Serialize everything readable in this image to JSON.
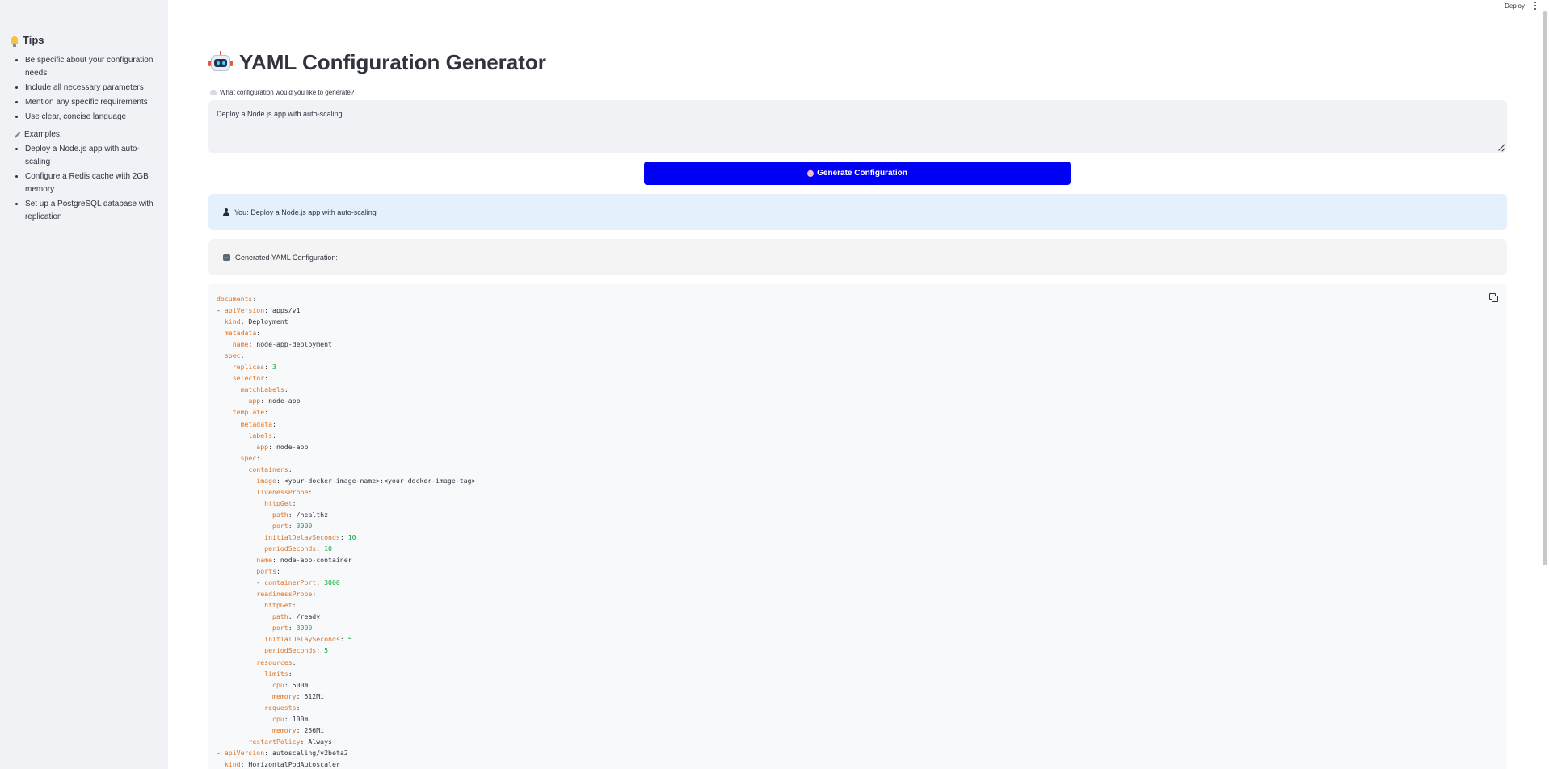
{
  "topbar": {
    "deploy_label": "Deploy"
  },
  "sidebar": {
    "tips_title": "Tips",
    "tips": [
      "Be specific about your configuration needs",
      "Include all necessary parameters",
      "Mention any specific requirements",
      "Use clear, concise language"
    ],
    "examples_title": "Examples:",
    "examples": [
      "Deploy a Node.js app with auto-scaling",
      "Configure a Redis cache with 2GB memory",
      "Set up a PostgreSQL database with replication"
    ]
  },
  "main": {
    "title": "YAML Configuration Generator",
    "prompt_label": "What configuration would you like to generate?",
    "prompt_value": "Deploy a Node.js app with auto-scaling",
    "generate_button": "Generate Configuration",
    "user_message": "You: Deploy a Node.js app with auto-scaling",
    "bot_message": "Generated YAML Configuration:"
  },
  "code": {
    "lines": [
      [
        [
          "k",
          "documents"
        ],
        [
          "p",
          ":"
        ]
      ],
      [
        [
          "p",
          "- "
        ],
        [
          "k",
          "apiVersion"
        ],
        [
          "p",
          ": apps/v1"
        ]
      ],
      [
        [
          "p",
          "  "
        ],
        [
          "k",
          "kind"
        ],
        [
          "p",
          ": Deployment"
        ]
      ],
      [
        [
          "p",
          "  "
        ],
        [
          "k",
          "metadata"
        ],
        [
          "p",
          ":"
        ]
      ],
      [
        [
          "p",
          "    "
        ],
        [
          "k",
          "name"
        ],
        [
          "p",
          ": node-app-deployment"
        ]
      ],
      [
        [
          "p",
          "  "
        ],
        [
          "k",
          "spec"
        ],
        [
          "p",
          ":"
        ]
      ],
      [
        [
          "p",
          "    "
        ],
        [
          "k",
          "replicas"
        ],
        [
          "p",
          ": "
        ],
        [
          "n",
          "3"
        ]
      ],
      [
        [
          "p",
          "    "
        ],
        [
          "k",
          "selector"
        ],
        [
          "p",
          ":"
        ]
      ],
      [
        [
          "p",
          "      "
        ],
        [
          "k",
          "matchLabels"
        ],
        [
          "p",
          ":"
        ]
      ],
      [
        [
          "p",
          "        "
        ],
        [
          "k",
          "app"
        ],
        [
          "p",
          ": node-app"
        ]
      ],
      [
        [
          "p",
          "    "
        ],
        [
          "k",
          "template"
        ],
        [
          "p",
          ":"
        ]
      ],
      [
        [
          "p",
          "      "
        ],
        [
          "k",
          "metadata"
        ],
        [
          "p",
          ":"
        ]
      ],
      [
        [
          "p",
          "        "
        ],
        [
          "k",
          "labels"
        ],
        [
          "p",
          ":"
        ]
      ],
      [
        [
          "p",
          "          "
        ],
        [
          "k",
          "app"
        ],
        [
          "p",
          ": node-app"
        ]
      ],
      [
        [
          "p",
          "      "
        ],
        [
          "k",
          "spec"
        ],
        [
          "p",
          ":"
        ]
      ],
      [
        [
          "p",
          "        "
        ],
        [
          "k",
          "containers"
        ],
        [
          "p",
          ":"
        ]
      ],
      [
        [
          "p",
          "        - "
        ],
        [
          "k",
          "image"
        ],
        [
          "p",
          ": <your-docker-image-name>:<your-docker-image-tag>"
        ]
      ],
      [
        [
          "p",
          "          "
        ],
        [
          "k",
          "livenessProbe"
        ],
        [
          "p",
          ":"
        ]
      ],
      [
        [
          "p",
          "            "
        ],
        [
          "k",
          "httpGet"
        ],
        [
          "p",
          ":"
        ]
      ],
      [
        [
          "p",
          "              "
        ],
        [
          "k",
          "path"
        ],
        [
          "p",
          ": /healthz"
        ]
      ],
      [
        [
          "p",
          "              "
        ],
        [
          "k",
          "port"
        ],
        [
          "p",
          ": "
        ],
        [
          "n",
          "3000"
        ]
      ],
      [
        [
          "p",
          "            "
        ],
        [
          "k",
          "initialDelaySeconds"
        ],
        [
          "p",
          ": "
        ],
        [
          "n",
          "10"
        ]
      ],
      [
        [
          "p",
          "            "
        ],
        [
          "k",
          "periodSeconds"
        ],
        [
          "p",
          ": "
        ],
        [
          "n",
          "10"
        ]
      ],
      [
        [
          "p",
          "          "
        ],
        [
          "k",
          "name"
        ],
        [
          "p",
          ": node-app-container"
        ]
      ],
      [
        [
          "p",
          "          "
        ],
        [
          "k",
          "ports"
        ],
        [
          "p",
          ":"
        ]
      ],
      [
        [
          "p",
          "          - "
        ],
        [
          "k",
          "containerPort"
        ],
        [
          "p",
          ": "
        ],
        [
          "n",
          "3000"
        ]
      ],
      [
        [
          "p",
          "          "
        ],
        [
          "k",
          "readinessProbe"
        ],
        [
          "p",
          ":"
        ]
      ],
      [
        [
          "p",
          "            "
        ],
        [
          "k",
          "httpGet"
        ],
        [
          "p",
          ":"
        ]
      ],
      [
        [
          "p",
          "              "
        ],
        [
          "k",
          "path"
        ],
        [
          "p",
          ": /ready"
        ]
      ],
      [
        [
          "p",
          "              "
        ],
        [
          "k",
          "port"
        ],
        [
          "p",
          ": "
        ],
        [
          "n",
          "3000"
        ]
      ],
      [
        [
          "p",
          "            "
        ],
        [
          "k",
          "initialDelaySeconds"
        ],
        [
          "p",
          ": "
        ],
        [
          "n",
          "5"
        ]
      ],
      [
        [
          "p",
          "            "
        ],
        [
          "k",
          "periodSeconds"
        ],
        [
          "p",
          ": "
        ],
        [
          "n",
          "5"
        ]
      ],
      [
        [
          "p",
          "          "
        ],
        [
          "k",
          "resources"
        ],
        [
          "p",
          ":"
        ]
      ],
      [
        [
          "p",
          "            "
        ],
        [
          "k",
          "limits"
        ],
        [
          "p",
          ":"
        ]
      ],
      [
        [
          "p",
          "              "
        ],
        [
          "k",
          "cpu"
        ],
        [
          "p",
          ": 500m"
        ]
      ],
      [
        [
          "p",
          "              "
        ],
        [
          "k",
          "memory"
        ],
        [
          "p",
          ": 512Mi"
        ]
      ],
      [
        [
          "p",
          "            "
        ],
        [
          "k",
          "requests"
        ],
        [
          "p",
          ":"
        ]
      ],
      [
        [
          "p",
          "              "
        ],
        [
          "k",
          "cpu"
        ],
        [
          "p",
          ": 100m"
        ]
      ],
      [
        [
          "p",
          "              "
        ],
        [
          "k",
          "memory"
        ],
        [
          "p",
          ": 256Mi"
        ]
      ],
      [
        [
          "p",
          "        "
        ],
        [
          "k",
          "restartPolicy"
        ],
        [
          "p",
          ": Always"
        ]
      ],
      [
        [
          "p",
          "- "
        ],
        [
          "k",
          "apiVersion"
        ],
        [
          "p",
          ": autoscaling/v2beta2"
        ]
      ],
      [
        [
          "p",
          "  "
        ],
        [
          "k",
          "kind"
        ],
        [
          "p",
          ": HorizontalPodAutoscaler"
        ]
      ]
    ]
  }
}
